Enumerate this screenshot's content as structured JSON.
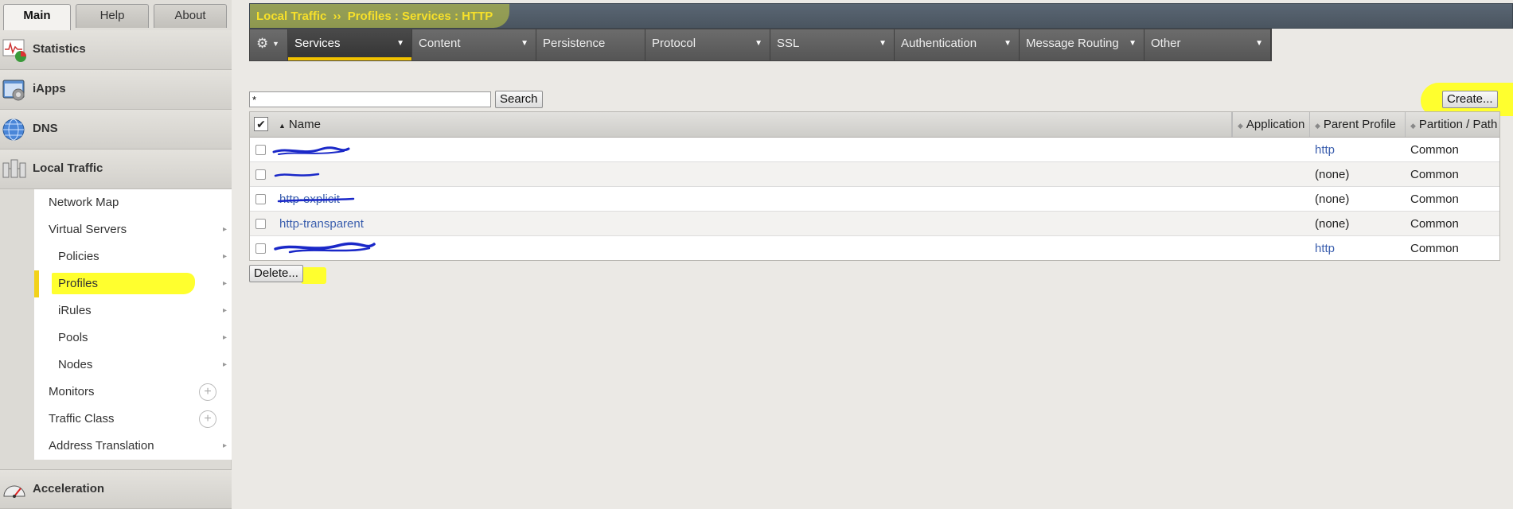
{
  "top_tabs": [
    {
      "label": "Main",
      "active": true
    },
    {
      "label": "Help",
      "active": false
    },
    {
      "label": "About",
      "active": false
    }
  ],
  "sidebar": {
    "sections": [
      {
        "label": "Statistics",
        "icon": "statistics-icon"
      },
      {
        "label": "iApps",
        "icon": "iapps-icon"
      },
      {
        "label": "DNS",
        "icon": "dns-globe-icon"
      },
      {
        "label": "Local Traffic",
        "icon": "local-traffic-icon"
      },
      {
        "label": "Acceleration",
        "icon": "acceleration-gauge-icon"
      }
    ],
    "local_traffic_items": [
      {
        "label": "Network Map"
      },
      {
        "label": "Virtual Servers"
      },
      {
        "label": "Policies"
      },
      {
        "label": "Profiles",
        "selected": true
      },
      {
        "label": "iRules"
      },
      {
        "label": "Pools"
      },
      {
        "label": "Nodes"
      },
      {
        "label": "Monitors"
      },
      {
        "label": "Traffic Class"
      },
      {
        "label": "Address Translation"
      }
    ]
  },
  "breadcrumb": {
    "section": "Local Traffic",
    "separator": "››",
    "path": "Profiles : Services : HTTP"
  },
  "nav": [
    {
      "label": "Services",
      "active": true
    },
    {
      "label": "Content"
    },
    {
      "label": "Persistence"
    },
    {
      "label": "Protocol"
    },
    {
      "label": "SSL"
    },
    {
      "label": "Authentication"
    },
    {
      "label": "Message Routing"
    },
    {
      "label": "Other"
    }
  ],
  "search": {
    "value": "*",
    "button": "Search"
  },
  "create_button": "Create...",
  "delete_button": "Delete...",
  "table": {
    "columns": [
      "Name",
      "Application",
      "Parent Profile",
      "Partition / Path"
    ],
    "rows": [
      {
        "name": "",
        "application": "",
        "parent": "http",
        "partition": "Common"
      },
      {
        "name": "",
        "application": "",
        "parent": "(none)",
        "partition": "Common"
      },
      {
        "name": "http-explicit",
        "application": "",
        "parent": "(none)",
        "partition": "Common"
      },
      {
        "name": "http-transparent",
        "application": "",
        "parent": "(none)",
        "partition": "Common"
      },
      {
        "name": "",
        "application": "",
        "parent": "http",
        "partition": "Common"
      }
    ]
  },
  "colors": {
    "highlight": "#ffff2e",
    "breadcrumb_text": "#f7e02a",
    "link": "#3b5fae",
    "nav_active_underline": "#f2c200",
    "scribble": "#1a28c8"
  }
}
